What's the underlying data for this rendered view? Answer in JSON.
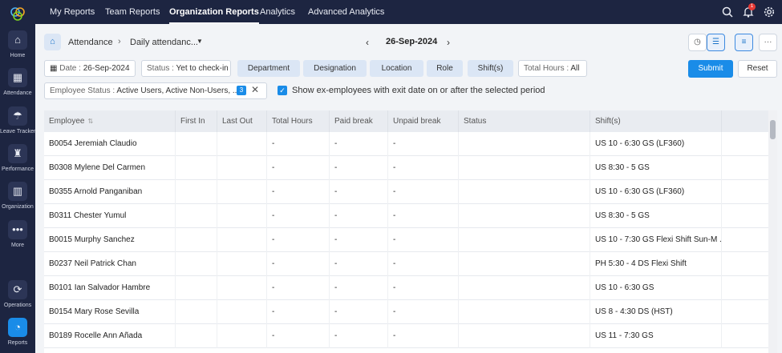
{
  "nav": {
    "tabs": [
      {
        "label": "My Reports"
      },
      {
        "label": "Team Reports"
      },
      {
        "label": "Organization Reports"
      },
      {
        "label": "Analytics"
      },
      {
        "label": "Advanced Analytics"
      }
    ],
    "notification_count": "1"
  },
  "rail": {
    "items": [
      {
        "label": "Home",
        "icon": "home-icon"
      },
      {
        "label": "Attendance",
        "icon": "calendar-check-icon"
      },
      {
        "label": "Leave Tracker",
        "icon": "beach-icon"
      },
      {
        "label": "Performance",
        "icon": "trophy-icon"
      },
      {
        "label": "Organization",
        "icon": "building-icon"
      },
      {
        "label": "More",
        "icon": "more-dots-icon"
      },
      {
        "label": "Operations",
        "icon": "operations-icon"
      },
      {
        "label": "Reports",
        "icon": "pie-chart-icon"
      }
    ]
  },
  "breadcrumb": {
    "section": "Attendance",
    "report": "Daily attendanc..."
  },
  "date_nav": {
    "date": "26-Sep-2024"
  },
  "filters": {
    "date_label": "Date :",
    "date_value": "26-Sep-2024",
    "status_label": "Status :",
    "status_value": "Yet to check-in",
    "department": "Department",
    "designation": "Designation",
    "location": "Location",
    "role": "Role",
    "shifts": "Shift(s)",
    "total_hours_label": "Total Hours :",
    "total_hours_value": "All",
    "submit": "Submit",
    "reset": "Reset",
    "employee_status_label": "Employee Status :",
    "employee_status_value": "Active Users, Active Non-Users, ...",
    "employee_status_count": "3",
    "ex_employees_label": "Show ex-employees with exit date on or after the selected period"
  },
  "table": {
    "headers": [
      "Employee",
      "First In",
      "Last Out",
      "Total Hours",
      "Paid break",
      "Unpaid break",
      "Status",
      "Shift(s)"
    ],
    "rows": [
      {
        "employee": "B0054 Jeremiah Claudio",
        "first_in": "",
        "last_out": "",
        "total_hours": "-",
        "paid_break": "-",
        "unpaid_break": "-",
        "status": "",
        "shift": "US 10 - 6:30 GS (LF360)"
      },
      {
        "employee": "B0308 Mylene Del Carmen",
        "first_in": "",
        "last_out": "",
        "total_hours": "-",
        "paid_break": "-",
        "unpaid_break": "-",
        "status": "",
        "shift": "US 8:30 - 5 GS"
      },
      {
        "employee": "B0355 Arnold Panganiban",
        "first_in": "",
        "last_out": "",
        "total_hours": "-",
        "paid_break": "-",
        "unpaid_break": "-",
        "status": "",
        "shift": "US 10 - 6:30 GS (LF360)"
      },
      {
        "employee": "B0311 Chester Yumul",
        "first_in": "",
        "last_out": "",
        "total_hours": "-",
        "paid_break": "-",
        "unpaid_break": "-",
        "status": "",
        "shift": "US 8:30 - 5 GS"
      },
      {
        "employee": "B0015 Murphy Sanchez",
        "first_in": "",
        "last_out": "",
        "total_hours": "-",
        "paid_break": "-",
        "unpaid_break": "-",
        "status": "",
        "shift": "US 10 - 7:30 GS Flexi Shift Sun-M ..."
      },
      {
        "employee": "B0237 Neil Patrick Chan",
        "first_in": "",
        "last_out": "",
        "total_hours": "-",
        "paid_break": "-",
        "unpaid_break": "-",
        "status": "",
        "shift": "PH 5:30 - 4 DS Flexi Shift"
      },
      {
        "employee": "B0101 Ian Salvador Hambre",
        "first_in": "",
        "last_out": "",
        "total_hours": "-",
        "paid_break": "-",
        "unpaid_break": "-",
        "status": "",
        "shift": "US 10 - 6:30 GS"
      },
      {
        "employee": "B0154 Mary Rose Sevilla",
        "first_in": "",
        "last_out": "",
        "total_hours": "-",
        "paid_break": "-",
        "unpaid_break": "-",
        "status": "",
        "shift": "US 8 - 4:30 DS (HST)"
      },
      {
        "employee": "B0189 Rocelle Ann Añada",
        "first_in": "",
        "last_out": "",
        "total_hours": "-",
        "paid_break": "-",
        "unpaid_break": "-",
        "status": "",
        "shift": "US 11 - 7:30 GS"
      }
    ]
  },
  "colors": {
    "nav_bg": "#1d2541",
    "accent": "#1a8ce8",
    "chip_bg": "#dbe6f5"
  }
}
